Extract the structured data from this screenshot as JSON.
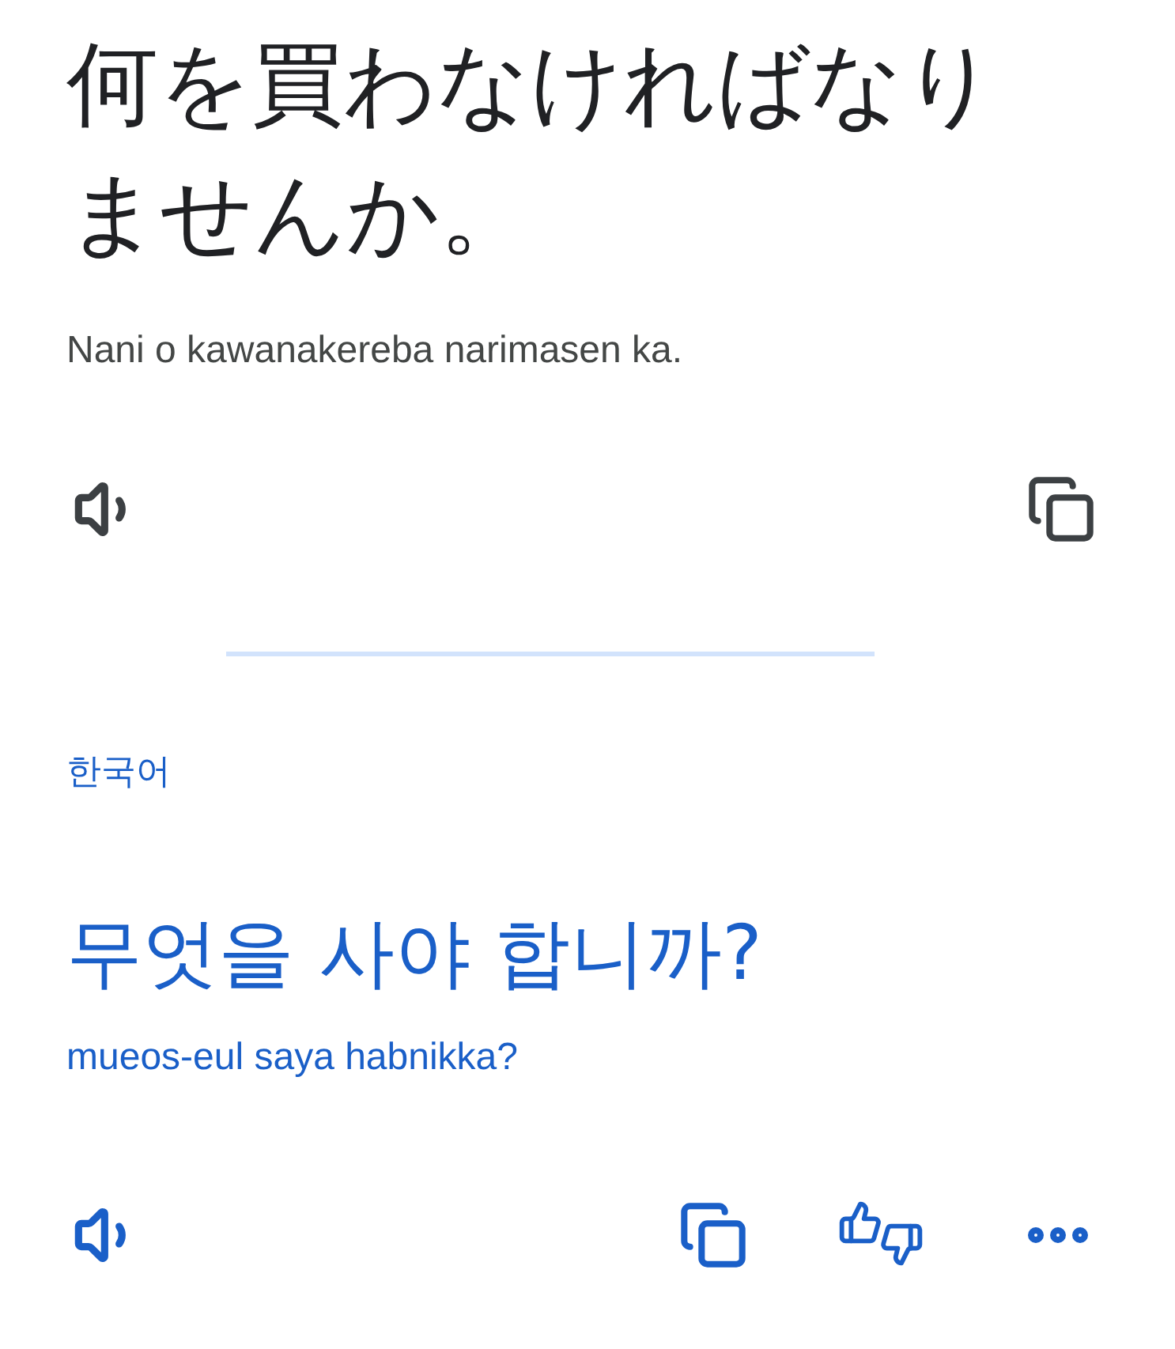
{
  "source": {
    "text": "何を買わなければなりませんか。",
    "romanization": "Nani o kawanakereba narimasen ka."
  },
  "target": {
    "language": "한국어",
    "text": "무엇을 사야 합니까?",
    "romanization": "mueos-eul saya habnikka?"
  }
}
